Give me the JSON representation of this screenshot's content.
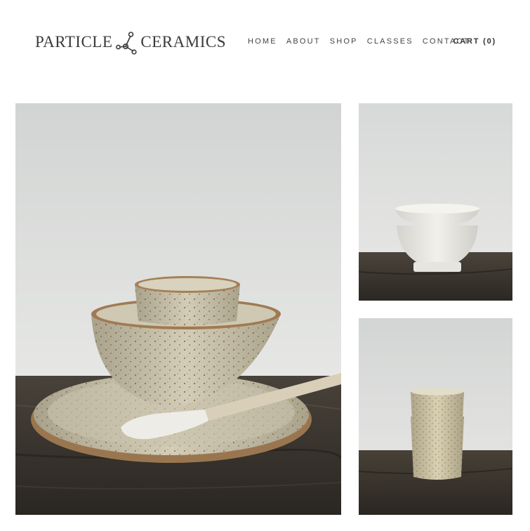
{
  "brand": {
    "name_left": "PARTICLE",
    "name_right": "CERAMICS",
    "logo_icon": "molecule-icon"
  },
  "nav": {
    "items": [
      {
        "label": "HOME"
      },
      {
        "label": "ABOUT"
      },
      {
        "label": "SHOP"
      },
      {
        "label": "CLASSES"
      },
      {
        "label": "CONTACT"
      }
    ],
    "cart_label": "CART (0)"
  },
  "gallery": {
    "images": [
      {
        "subject": "speckled stoneware plate, bowl and cup set with ceramic spoon on dark wooden table"
      },
      {
        "subject": "two stacked white porcelain bowls on dark wooden table"
      },
      {
        "subject": "two stacked speckled tumbler cups on dark wooden table"
      }
    ]
  },
  "colors": {
    "wall": "#dcdedc",
    "wood": "#3a352f",
    "speckled_glaze": "#c9c2a8",
    "porcelain": "#ecebe4",
    "text": "#333333"
  }
}
